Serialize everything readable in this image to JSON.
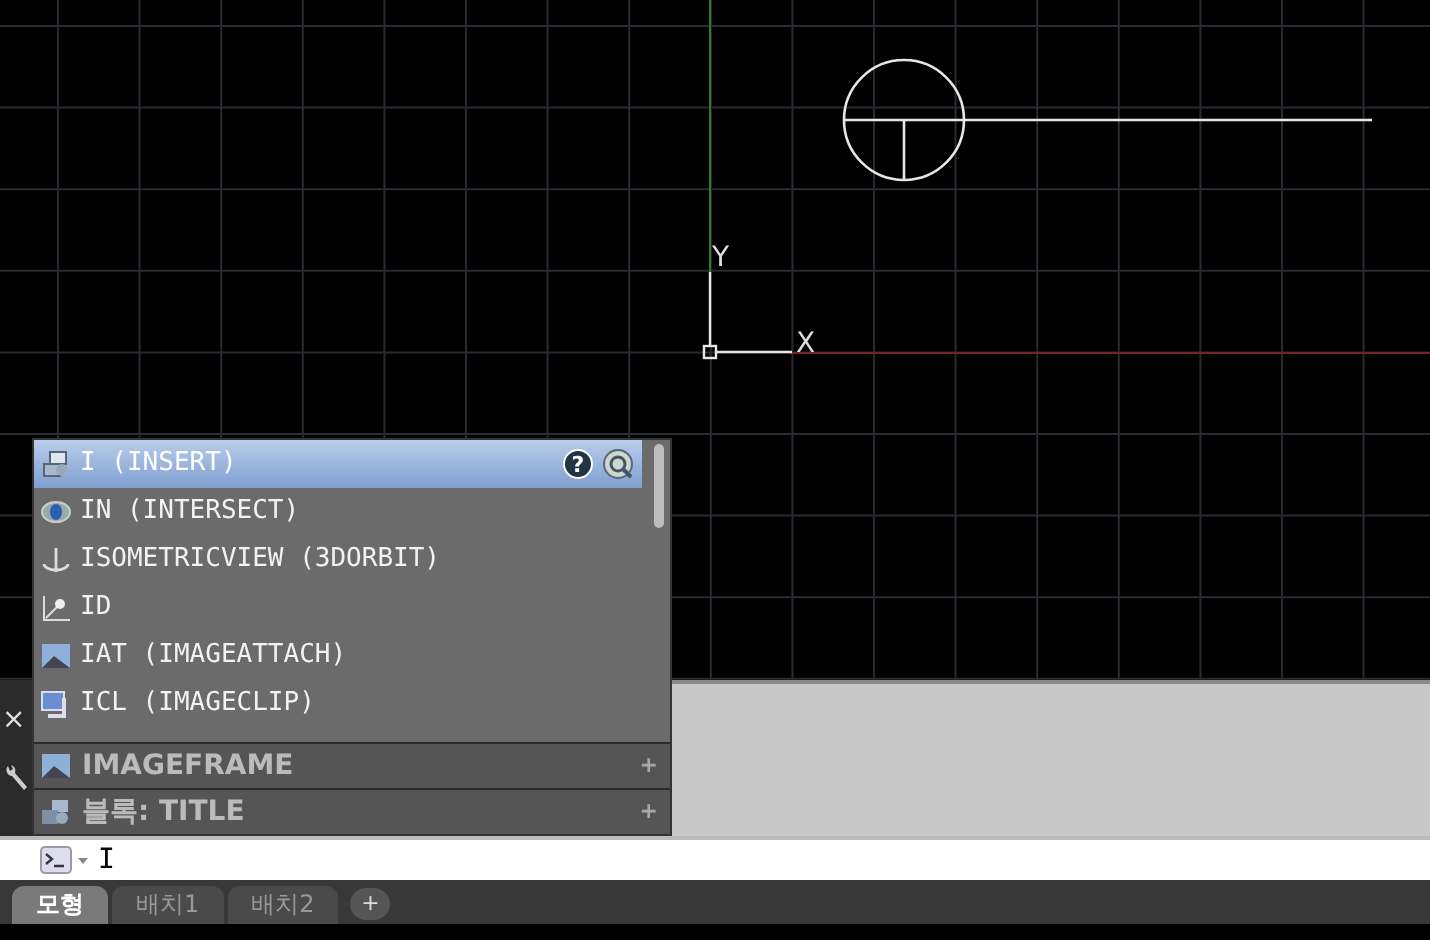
{
  "drawing": {
    "x_axis_label": "X",
    "y_axis_label": "Y"
  },
  "autocomplete": {
    "items": [
      {
        "label": "I (INSERT)",
        "kind": "insert",
        "selected": true,
        "help_glyph": "?"
      },
      {
        "label": "IN (INTERSECT)",
        "kind": "intersect",
        "selected": false
      },
      {
        "label": "ISOMETRICVIEW (3DORBIT)",
        "kind": "orbit",
        "selected": false
      },
      {
        "label": "ID",
        "kind": "id",
        "selected": false
      },
      {
        "label": "IAT (IMAGEATTACH)",
        "kind": "image",
        "selected": false
      },
      {
        "label": "ICL (IMAGECLIP)",
        "kind": "clip",
        "selected": false
      }
    ],
    "categories": [
      {
        "label": "IMAGEFRAME",
        "kind": "image",
        "toggle": "+"
      },
      {
        "label": "블록: TITLE",
        "kind": "block",
        "toggle": "+"
      }
    ]
  },
  "command_line": {
    "close_glyph": "×",
    "value": "I"
  },
  "layout_tabs": [
    {
      "label": "모형",
      "selected": true
    },
    {
      "label": "배치1",
      "selected": false
    },
    {
      "label": "배치2",
      "selected": false
    }
  ],
  "add_tab": "+"
}
